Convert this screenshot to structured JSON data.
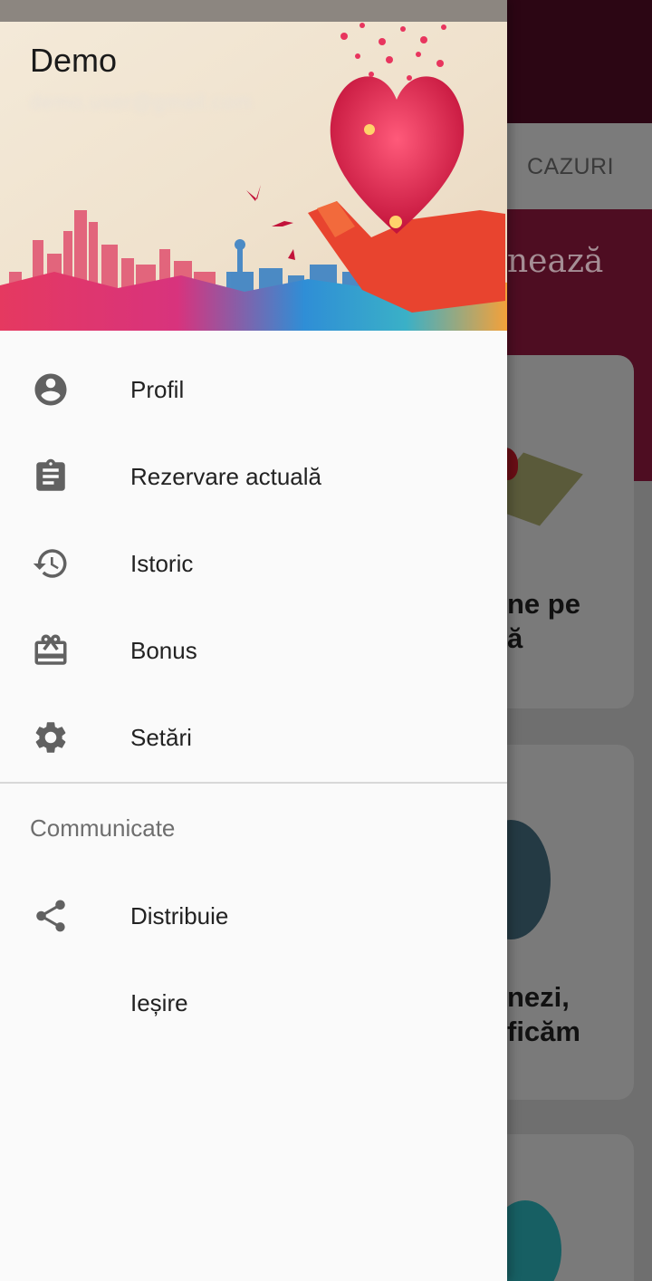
{
  "background": {
    "tab_label": "CAZURI",
    "hero_text": "nează",
    "cards": [
      {
        "text": "ne pe\nă"
      },
      {
        "text": "nezi,\nficăm"
      }
    ]
  },
  "drawer": {
    "user": {
      "name": "Demo",
      "email": "demo.user@gmail.com"
    },
    "menu": [
      {
        "label": "Profil",
        "icon": "account-circle-icon"
      },
      {
        "label": "Rezervare actuală",
        "icon": "clipboard-icon"
      },
      {
        "label": "Istoric",
        "icon": "history-icon"
      },
      {
        "label": "Bonus",
        "icon": "gift-card-icon"
      },
      {
        "label": "Setări",
        "icon": "gear-icon"
      }
    ],
    "section_title": "Communicate",
    "section_items": [
      {
        "label": "Distribuie",
        "icon": "share-icon"
      },
      {
        "label": "Ieșire",
        "icon": ""
      }
    ]
  },
  "colors": {
    "icon": "#616161",
    "text": "#222222",
    "section_title": "#6e6e6e",
    "app_bar": "#2c0614"
  }
}
